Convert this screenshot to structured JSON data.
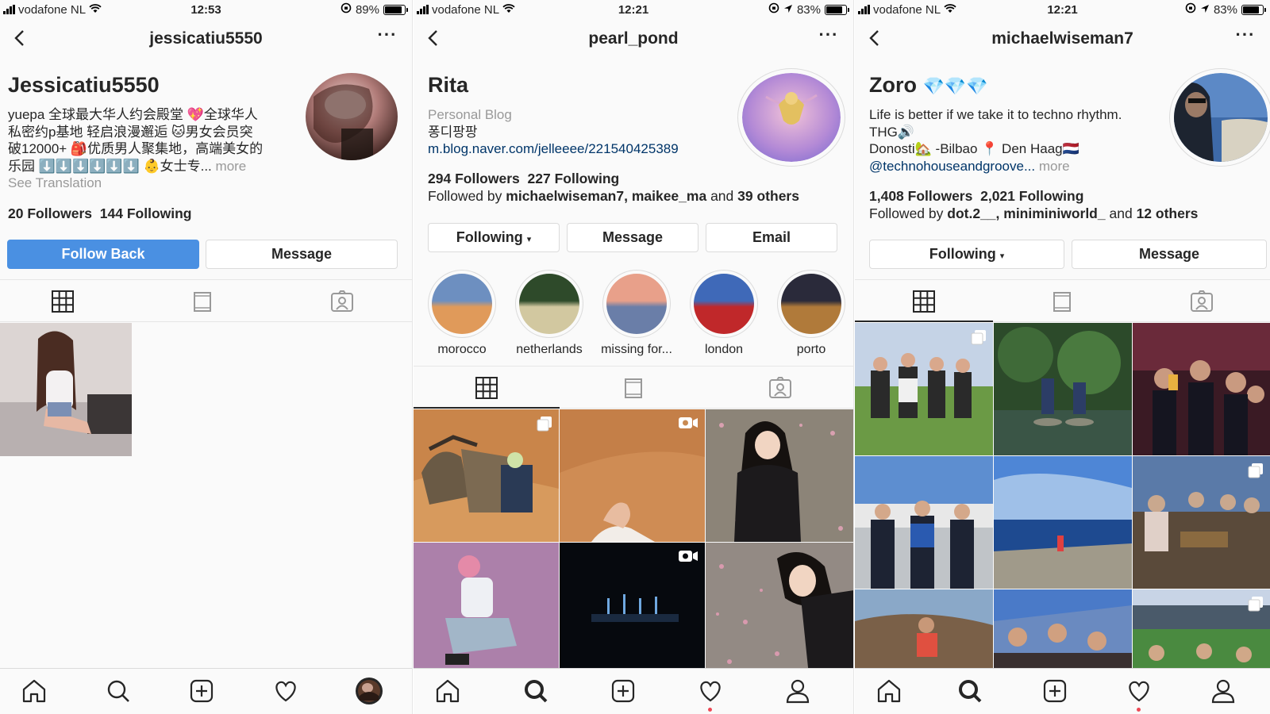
{
  "screens": [
    {
      "status": {
        "carrier": "vodafone NL",
        "time": "12:53",
        "battery": "89%",
        "battery_level": 0.89
      },
      "username": "jessicatiu5550",
      "display_name": "Jessicatiu5550",
      "bio_lines": [
        "yuepa 全球最大华人约会殿堂 💖全球华人",
        "私密约p基地 轻启浪漫邂逅 🐱男女会员突",
        "破12000+ 🎒优质男人聚集地，高端美女的",
        "乐园 ⬇️⬇️⬇️⬇️⬇️⬇️ 👶女士专..."
      ],
      "more": "more",
      "see_translation": "See Translation",
      "followers_count": "20",
      "followers_label": "Followers",
      "following_count": "144",
      "following_label": "Following",
      "buttons": {
        "follow_back": "Follow Back",
        "message": "Message"
      },
      "icons": {
        "back": "chevron-left-icon",
        "more": "ellipsis-icon"
      }
    },
    {
      "status": {
        "carrier": "vodafone NL",
        "time": "12:21",
        "battery": "83%",
        "battery_level": 0.83
      },
      "username": "pearl_pond",
      "display_name": "Rita",
      "category": "Personal Blog",
      "bio_line": "퐁디팡팡",
      "link": "m.blog.naver.com/jelleeee/221540425389",
      "followers_count": "294",
      "followers_label": "Followers",
      "following_count": "227",
      "following_label": "Following",
      "followed_by_prefix": "Followed by",
      "followed_by_names": "michaelwiseman7, maikee_ma",
      "followed_by_and": "and",
      "followed_by_others": "39 others",
      "buttons": {
        "following": "Following",
        "message": "Message",
        "email": "Email"
      },
      "highlights": [
        {
          "label": "morocco",
          "colors": [
            "#6d8fc0",
            "#e09a5a"
          ]
        },
        {
          "label": "netherlands",
          "colors": [
            "#2e4a2a",
            "#d2c8a0"
          ]
        },
        {
          "label": "missing for...",
          "colors": [
            "#e8a08a",
            "#6a7ea8"
          ]
        },
        {
          "label": "london",
          "colors": [
            "#3f69b8",
            "#c0282a"
          ]
        },
        {
          "label": "porto",
          "colors": [
            "#2a2a3a",
            "#b07a3a"
          ]
        }
      ]
    },
    {
      "status": {
        "carrier": "vodafone NL",
        "time": "12:21",
        "battery": "83%",
        "battery_level": 0.83
      },
      "username": "michaelwiseman7",
      "display_name": "Zoro",
      "name_emoji": "💎💎💎",
      "bio_lines": [
        "Life is better if we take it to techno rhythm.",
        "THG🔊",
        "Donosti🏡 -Bilbao 📍 Den Haag🇳🇱"
      ],
      "mention": "@technohouseandgroove...",
      "more": "more",
      "followers_count": "1,408",
      "followers_label": "Followers",
      "following_count": "2,021",
      "following_label": "Following",
      "followed_by_prefix": "Followed by",
      "followed_by_names": "dot.2__, miniminiworld_",
      "followed_by_and": "and",
      "followed_by_others": "12 others",
      "buttons": {
        "following": "Following",
        "message": "Message"
      }
    }
  ],
  "colors": {
    "accent": "#4a90e2",
    "link": "#003569",
    "notification": "#ed4956",
    "muted": "#999999"
  },
  "tab_icons": [
    "grid-icon",
    "feed-icon",
    "tagged-icon"
  ],
  "bottom_nav_icons": [
    "home-icon",
    "search-icon",
    "new-post-icon",
    "activity-heart-icon",
    "profile-icon"
  ]
}
